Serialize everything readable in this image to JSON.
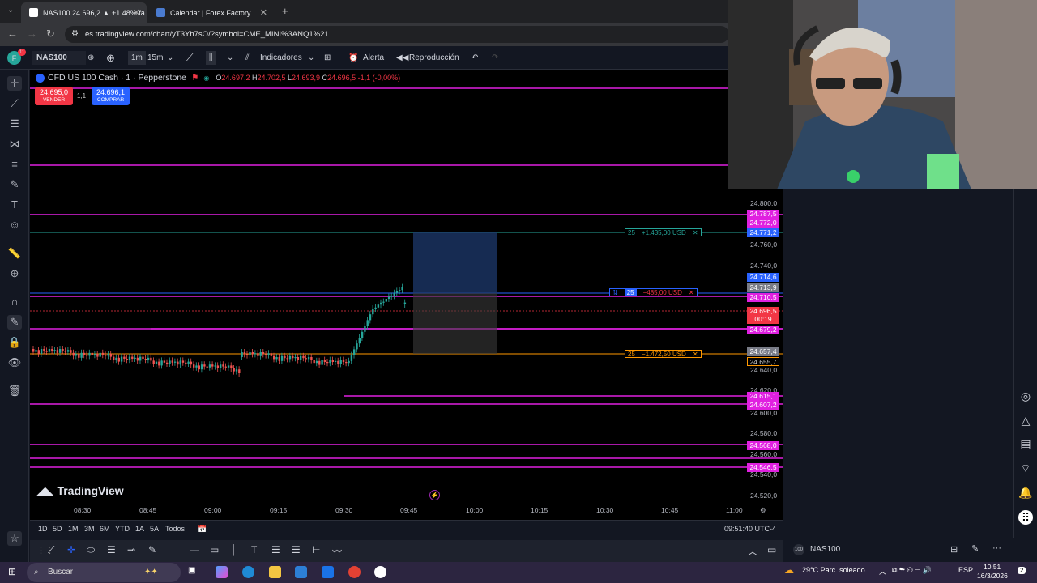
{
  "browser": {
    "tabs": [
      {
        "label": "NAS100 24.696,2 ▲ +1.48% fa"
      },
      {
        "label": "Calendar | Forex Factory"
      }
    ],
    "url": "es.tradingview.com/chart/yT3Yh7sO/?symbol=CME_MINI%3ANQ1%21"
  },
  "toolbar": {
    "symbol": "NAS100",
    "interval_1": "1m",
    "interval_2": "15m",
    "indicators": "Indicadores",
    "alert": "Alerta",
    "replay": "Reproducción"
  },
  "legend": {
    "title": "CFD US 100 Cash · 1 · Pepperstone",
    "open": "24.697,2",
    "high": "24.702,5",
    "low": "24.693,9",
    "close": "24.696,5",
    "change": "-1,1 (-0,00%)"
  },
  "trade": {
    "sell_price": "24.695,0",
    "sell_label": "VENDER",
    "spread": "1,1",
    "buy_price": "24.696,1",
    "buy_label": "COMPRAR"
  },
  "axis_prices": [
    "24.800,0",
    "24.760,0",
    "24.740,0",
    "24.640,0",
    "24.620,0",
    "24.600,0",
    "24.580,0",
    "24.560,0",
    "24.540,0",
    "24.520,0"
  ],
  "price_labels": [
    {
      "v": "24.787,5",
      "c": "#e020e0"
    },
    {
      "v": "24.772,0",
      "c": "#e020e0"
    },
    {
      "v": "24.771,2",
      "c": "#2962ff"
    },
    {
      "v": "24.714,6",
      "c": "#2962ff"
    },
    {
      "v": "24.713,9",
      "c": "#787b86"
    },
    {
      "v": "24.710,5",
      "c": "#e020e0"
    },
    {
      "v": "24.696,5",
      "c": "#f23645"
    },
    {
      "v": "00:19",
      "c": "#f23645"
    },
    {
      "v": "24.679,2",
      "c": "#e020e0"
    },
    {
      "v": "24.657,4",
      "c": "#787b86"
    },
    {
      "v": "24.655,7",
      "c": "#000000"
    },
    {
      "v": "24.615,1",
      "c": "#e020e0"
    },
    {
      "v": "24.607,2",
      "c": "#e020e0"
    },
    {
      "v": "24.568,0",
      "c": "#e020e0"
    },
    {
      "v": "24.546,5",
      "c": "#e020e0"
    }
  ],
  "orders": {
    "tp": {
      "qty": "25",
      "pnl": "+1.435,00 USD"
    },
    "entry": {
      "qty": "25",
      "pnl": "−485,00 USD"
    },
    "sl": {
      "qty": "25",
      "pnl": "−1.472,50 USD"
    }
  },
  "time_labels": [
    "08:30",
    "08:45",
    "09:00",
    "09:15",
    "09:30",
    "09:45",
    "10:00",
    "10:15",
    "10:30",
    "10:45",
    "11:00"
  ],
  "watermark": "TradingView",
  "bottom": {
    "ranges": [
      "1D",
      "5D",
      "1M",
      "3M",
      "6M",
      "YTD",
      "1A",
      "5A",
      "Todos"
    ],
    "clock": "09:51:40 UTC-4"
  },
  "sidepanel": {
    "symbol": "NAS100"
  },
  "taskbar": {
    "search": "Buscar",
    "weather": "29°C  Parc. soleado",
    "lang": "ESP",
    "time": "10:51",
    "date": "16/3/2026",
    "notif": "2"
  },
  "colors": {
    "bull": "#26a69a",
    "bear": "#ef5350",
    "level": "#e020e0"
  }
}
